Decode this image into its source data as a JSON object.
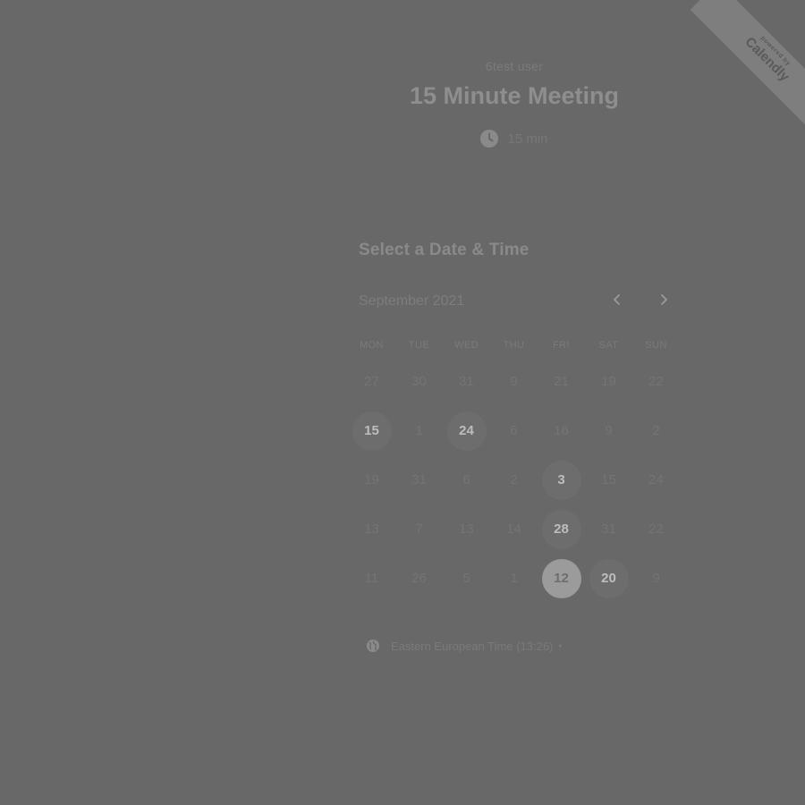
{
  "ribbon": {
    "small_text": "powered by",
    "brand_text": "Calendly"
  },
  "header": {
    "owner_name": "6test user",
    "event_title": "15 Minute Meeting",
    "duration": "15 min",
    "duration_icon": "clock-icon"
  },
  "scheduler": {
    "section_title": "Select a Date & Time",
    "month_label": "September 2021",
    "prev_icon": "chevron-left-icon",
    "next_icon": "chevron-right-icon",
    "weekdays": [
      "MON",
      "TUE",
      "WED",
      "THU",
      "FRI",
      "SAT",
      "SUN"
    ],
    "days": [
      {
        "label": "27",
        "state": "disabled"
      },
      {
        "label": "30",
        "state": "disabled"
      },
      {
        "label": "31",
        "state": "disabled"
      },
      {
        "label": "9",
        "state": "disabled"
      },
      {
        "label": "21",
        "state": "disabled"
      },
      {
        "label": "19",
        "state": "disabled"
      },
      {
        "label": "22",
        "state": "disabled"
      },
      {
        "label": "15",
        "state": "available"
      },
      {
        "label": "1",
        "state": "disabled"
      },
      {
        "label": "24",
        "state": "available"
      },
      {
        "label": "6",
        "state": "disabled"
      },
      {
        "label": "16",
        "state": "disabled"
      },
      {
        "label": "9",
        "state": "disabled"
      },
      {
        "label": "2",
        "state": "disabled"
      },
      {
        "label": "19",
        "state": "disabled"
      },
      {
        "label": "31",
        "state": "disabled"
      },
      {
        "label": "6",
        "state": "disabled"
      },
      {
        "label": "2",
        "state": "disabled"
      },
      {
        "label": "3",
        "state": "available"
      },
      {
        "label": "15",
        "state": "disabled"
      },
      {
        "label": "24",
        "state": "disabled"
      },
      {
        "label": "13",
        "state": "disabled"
      },
      {
        "label": "7",
        "state": "disabled"
      },
      {
        "label": "13",
        "state": "disabled"
      },
      {
        "label": "14",
        "state": "disabled"
      },
      {
        "label": "28",
        "state": "available"
      },
      {
        "label": "31",
        "state": "disabled"
      },
      {
        "label": "22",
        "state": "disabled"
      },
      {
        "label": "11",
        "state": "disabled"
      },
      {
        "label": "26",
        "state": "disabled"
      },
      {
        "label": "5",
        "state": "disabled"
      },
      {
        "label": "1",
        "state": "disabled"
      },
      {
        "label": "12",
        "state": "selected"
      },
      {
        "label": "20",
        "state": "available"
      },
      {
        "label": "9",
        "state": "disabled"
      }
    ],
    "timezone_label": "Eastern European Time (13:26)",
    "timezone_icon": "globe-icon",
    "timezone_caret": "▾"
  }
}
